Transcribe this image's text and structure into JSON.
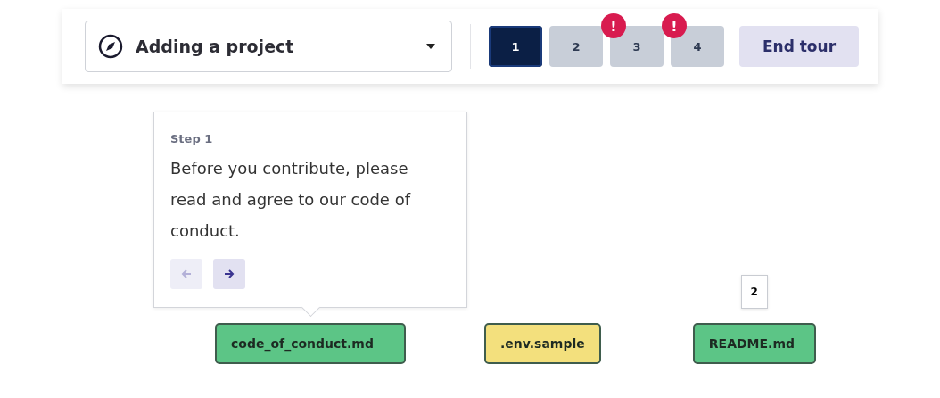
{
  "tour": {
    "title": "Adding a project",
    "steps": [
      {
        "label": "1",
        "selected": true,
        "warning": false
      },
      {
        "label": "2",
        "selected": false,
        "warning": false
      },
      {
        "label": "3",
        "selected": false,
        "warning": true
      },
      {
        "label": "4",
        "selected": false,
        "warning": true
      }
    ],
    "end_button": "End tour",
    "warning_mark": "!"
  },
  "popover": {
    "step": "Step 1",
    "text": "Before you contribute, please read and agree to our code of conduct.",
    "prev_disabled": true,
    "next_disabled": false
  },
  "files": [
    {
      "name": "code_of_conduct.md",
      "color": "#5cc586"
    },
    {
      "name": ".env.sample",
      "color": "#f3e07d"
    },
    {
      "name": "README.md",
      "color": "#5cc586",
      "callout": "2"
    }
  ]
}
